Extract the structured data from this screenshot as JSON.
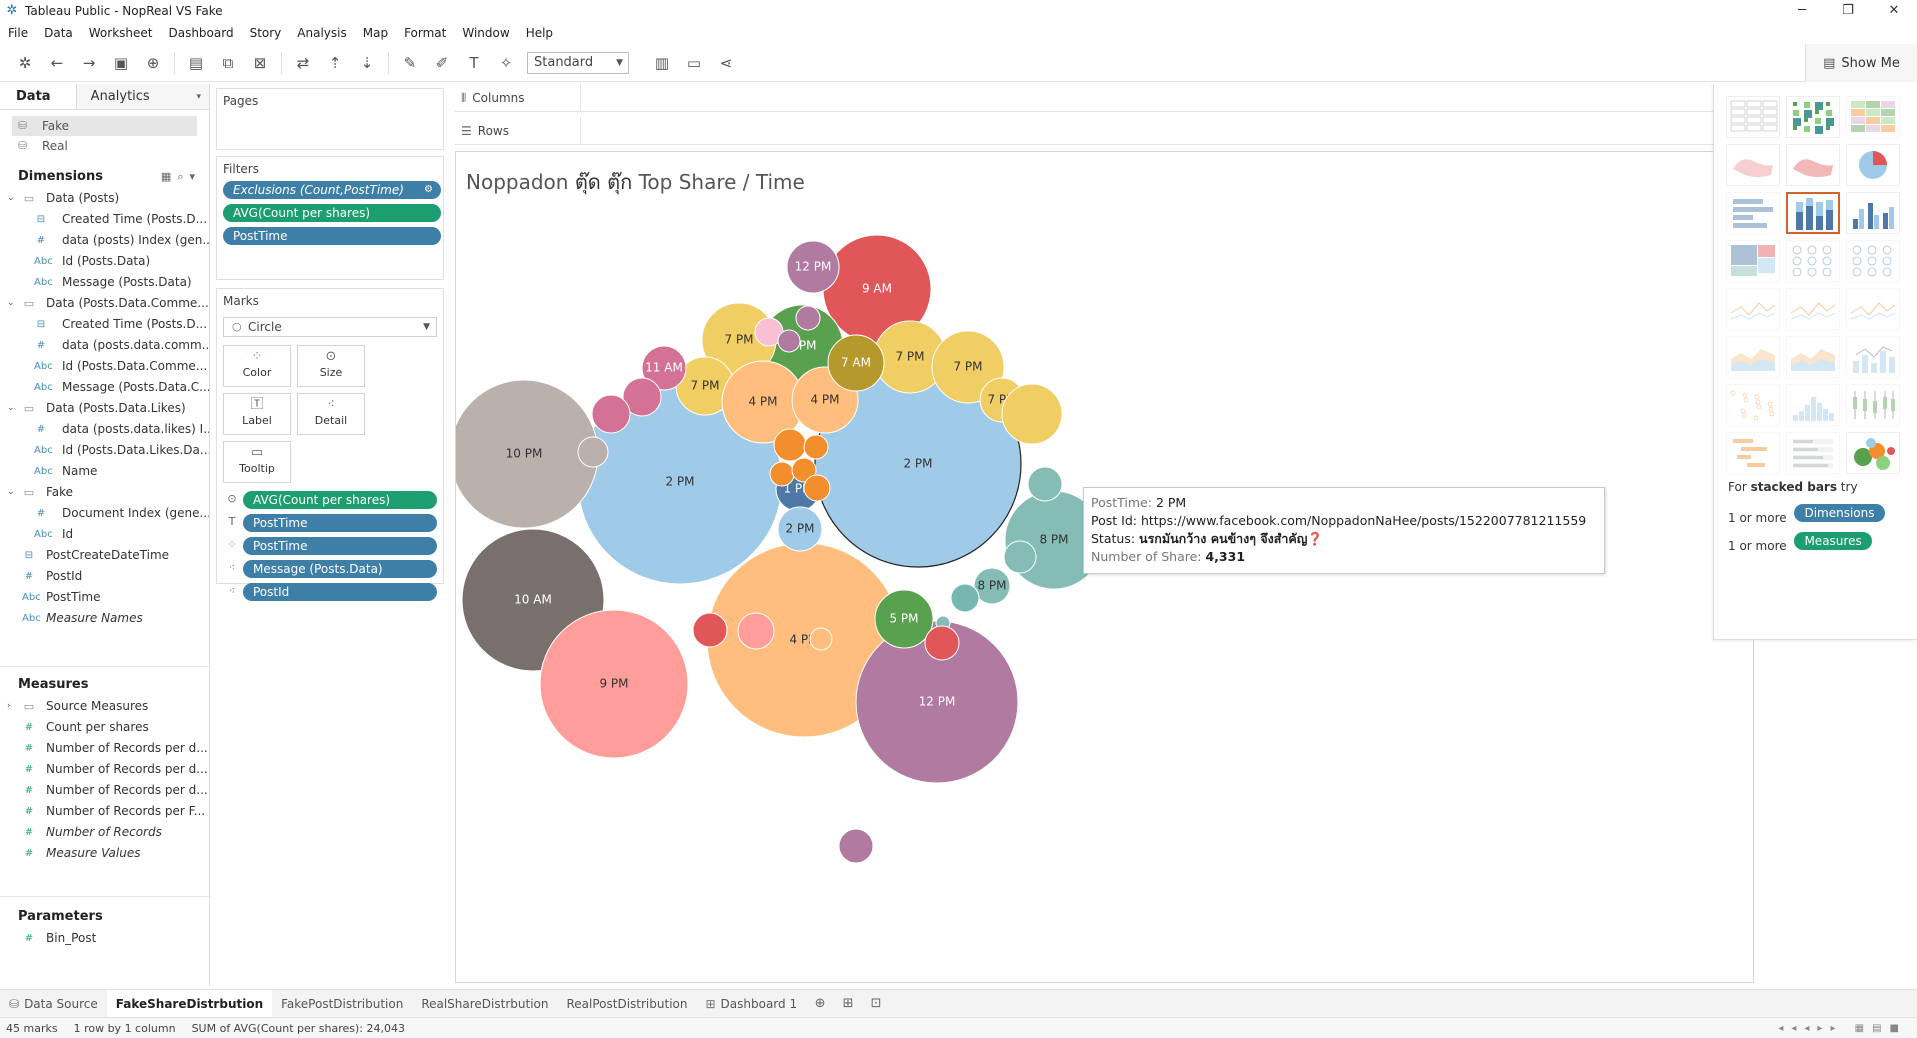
{
  "window": {
    "title": "Tableau Public - NopReal VS Fake",
    "controls": {
      "minimize": "─",
      "restore": "❐",
      "close": "✕"
    }
  },
  "menu": [
    "File",
    "Data",
    "Worksheet",
    "Dashboard",
    "Story",
    "Analysis",
    "Map",
    "Format",
    "Window",
    "Help"
  ],
  "toolbar": {
    "fit_value": "Standard",
    "show_me_label": "Show Me"
  },
  "data_pane": {
    "tabs": [
      "Data",
      "Analytics"
    ],
    "datasources": [
      {
        "name": "Fake",
        "selected": true
      },
      {
        "name": "Real",
        "selected": false
      }
    ],
    "dimensions_header": "Dimensions",
    "dimensions": [
      {
        "label": "Data (Posts)",
        "kind": "folder",
        "level": 0
      },
      {
        "label": "Created Time (Posts.D...",
        "kind": "date",
        "level": 1
      },
      {
        "label": "data (posts) Index (gen...",
        "kind": "number",
        "level": 1
      },
      {
        "label": "Id (Posts.Data)",
        "kind": "string",
        "level": 1
      },
      {
        "label": "Message (Posts.Data)",
        "kind": "string",
        "level": 1
      },
      {
        "label": "Data (Posts.Data.Comme...",
        "kind": "folder",
        "level": 0
      },
      {
        "label": "Created Time (Posts.D...",
        "kind": "date",
        "level": 1
      },
      {
        "label": "data (posts.data.comm...",
        "kind": "number",
        "level": 1
      },
      {
        "label": "Id (Posts.Data.Comme...",
        "kind": "string",
        "level": 1
      },
      {
        "label": "Message (Posts.Data.C...",
        "kind": "string",
        "level": 1
      },
      {
        "label": "Data (Posts.Data.Likes)",
        "kind": "folder",
        "level": 0
      },
      {
        "label": "data (posts.data.likes) I...",
        "kind": "number",
        "level": 1
      },
      {
        "label": "Id (Posts.Data.Likes.Da...",
        "kind": "string",
        "level": 1
      },
      {
        "label": "Name",
        "kind": "string",
        "level": 1
      },
      {
        "label": "Fake",
        "kind": "folder",
        "level": 0
      },
      {
        "label": "Document Index (gene...",
        "kind": "number",
        "level": 1
      },
      {
        "label": "Id",
        "kind": "string",
        "level": 1
      },
      {
        "label": "PostCreateDateTime",
        "kind": "date",
        "level": -1
      },
      {
        "label": "PostId",
        "kind": "number",
        "level": -1
      },
      {
        "label": "PostTime",
        "kind": "string",
        "level": -1
      },
      {
        "label": "Measure Names",
        "kind": "string",
        "level": -1,
        "italic": true
      }
    ],
    "measures_header": "Measures",
    "measures": [
      {
        "label": "Source Measures",
        "kind": "folder",
        "italic": false
      },
      {
        "label": "Count per shares",
        "kind": "number",
        "italic": false
      },
      {
        "label": "Number of Records per d...",
        "kind": "number",
        "italic": false
      },
      {
        "label": "Number of Records per d...",
        "kind": "number",
        "italic": false
      },
      {
        "label": "Number of Records per d...",
        "kind": "number",
        "italic": false
      },
      {
        "label": "Number of Records per F...",
        "kind": "number",
        "italic": false
      },
      {
        "label": "Number of Records",
        "kind": "number",
        "italic": true
      },
      {
        "label": "Measure Values",
        "kind": "number",
        "italic": true
      }
    ],
    "parameters_header": "Parameters",
    "parameters": [
      {
        "label": "Bin_Post",
        "kind": "number"
      }
    ]
  },
  "pages": {
    "title": "Pages"
  },
  "filters": {
    "title": "Filters",
    "pills": [
      {
        "label": "Exclusions (Count,PostTime)",
        "color": "blue",
        "italic": true
      },
      {
        "label": "AVG(Count per shares)",
        "color": "green",
        "italic": false
      },
      {
        "label": "PostTime",
        "color": "blue",
        "italic": false
      }
    ]
  },
  "marks": {
    "title": "Marks",
    "type": "Circle",
    "buttons": [
      "Color",
      "Size",
      "Label",
      "Detail",
      "Tooltip"
    ],
    "pills": [
      {
        "label": "AVG(Count per shares)",
        "color": "green",
        "role": "size"
      },
      {
        "label": "PostTime",
        "color": "blue",
        "role": "label"
      },
      {
        "label": "PostTime",
        "color": "blue",
        "role": "color"
      },
      {
        "label": "Message (Posts.Data)",
        "color": "blue",
        "role": "detail"
      },
      {
        "label": "PostId",
        "color": "blue",
        "role": "detail"
      }
    ]
  },
  "shelves": {
    "columns": "Columns",
    "rows": "Rows"
  },
  "view": {
    "title_prefix": "Noppadon ",
    "title_highlight": "ตุ๊ด ตุ๊ก",
    "title_suffix": " Top Share / Time"
  },
  "tooltip": {
    "rows": [
      {
        "key": "PostTime:",
        "value": "2 PM",
        "bold": false
      },
      {
        "key": "Post Id:",
        "value": "https://www.facebook.com/NoppadonNaHee/posts/1522007781211559",
        "bold": false,
        "dark_key": true
      },
      {
        "key": "Status:",
        "value": "นรกมันกว้าง คนข้างๆ จึงสำคัญ❓",
        "bold": true,
        "dark_key": true
      },
      {
        "key": "Number of Share:",
        "value": "4,331",
        "bold": true
      }
    ]
  },
  "show_me": {
    "hint_prefix": "For ",
    "hint_bold": "stacked bars",
    "hint_suffix": " try",
    "requirements": [
      {
        "text": "1 or more",
        "pill": "Dimensions",
        "color": "blue"
      },
      {
        "text": "1 or more",
        "pill": "Measures",
        "color": "green"
      }
    ]
  },
  "sheet_tabs": [
    {
      "label": "Data Source",
      "active": false,
      "icon": "database-icon"
    },
    {
      "label": "FakeShareDistrbution",
      "active": true
    },
    {
      "label": "FakePostDistribution",
      "active": false
    },
    {
      "label": "RealShareDistrbution",
      "active": false
    },
    {
      "label": "RealPostDistribution",
      "active": false
    },
    {
      "label": "Dashboard 1",
      "active": false,
      "icon": "dashboard-icon"
    }
  ],
  "status": {
    "marks": "45 marks",
    "layout": "1 row by 1 column",
    "sum": "SUM of AVG(Count per shares): 24,043"
  },
  "chart_data": {
    "type": "packed-bubble",
    "title": "Noppadon ตุ๊ด ตุ๊ก Top Share / Time",
    "size_measure": "AVG(Count per shares)",
    "color_dimension": "PostTime",
    "total_sum": 24043,
    "mark_count": 45,
    "labeled_bubbles": [
      {
        "label": "2 PM",
        "color": "#a0cbe8"
      },
      {
        "label": "2 PM",
        "color": "#a0cbe8"
      },
      {
        "label": "4 PM",
        "color": "#ffbe7d"
      },
      {
        "label": "12 PM",
        "color": "#b07aa1"
      },
      {
        "label": "10 PM",
        "color": "#bab0ac"
      },
      {
        "label": "10 AM",
        "color": "#79706e"
      },
      {
        "label": "9 PM",
        "color": "#ff9d9a"
      },
      {
        "label": "9 AM",
        "color": "#e15759"
      },
      {
        "label": "8 PM",
        "color": "#86bcb6"
      },
      {
        "label": "8 PM",
        "color": "#86bcb6"
      },
      {
        "label": "5 PM",
        "color": "#59a14f"
      },
      {
        "label": "5 PM",
        "color": "#59a14f"
      },
      {
        "label": "7 PM",
        "color": "#f1ce63"
      },
      {
        "label": "7 PM",
        "color": "#f1ce63"
      },
      {
        "label": "7 PM",
        "color": "#f1ce63"
      },
      {
        "label": "7 PM",
        "color": "#f1ce63"
      },
      {
        "label": "7 PM",
        "color": "#f1ce63"
      },
      {
        "label": "4 PM",
        "color": "#ffbe7d"
      },
      {
        "label": "4 PM",
        "color": "#ffbe7d"
      },
      {
        "label": "12 PM",
        "color": "#b07aa1"
      },
      {
        "label": "7 AM",
        "color": "#b6992d"
      },
      {
        "label": "11 AM",
        "color": "#d37295"
      },
      {
        "label": "1 PM",
        "color": "#4e79a7"
      },
      {
        "label": "2 PM",
        "color": "#a0cbe8"
      }
    ]
  }
}
